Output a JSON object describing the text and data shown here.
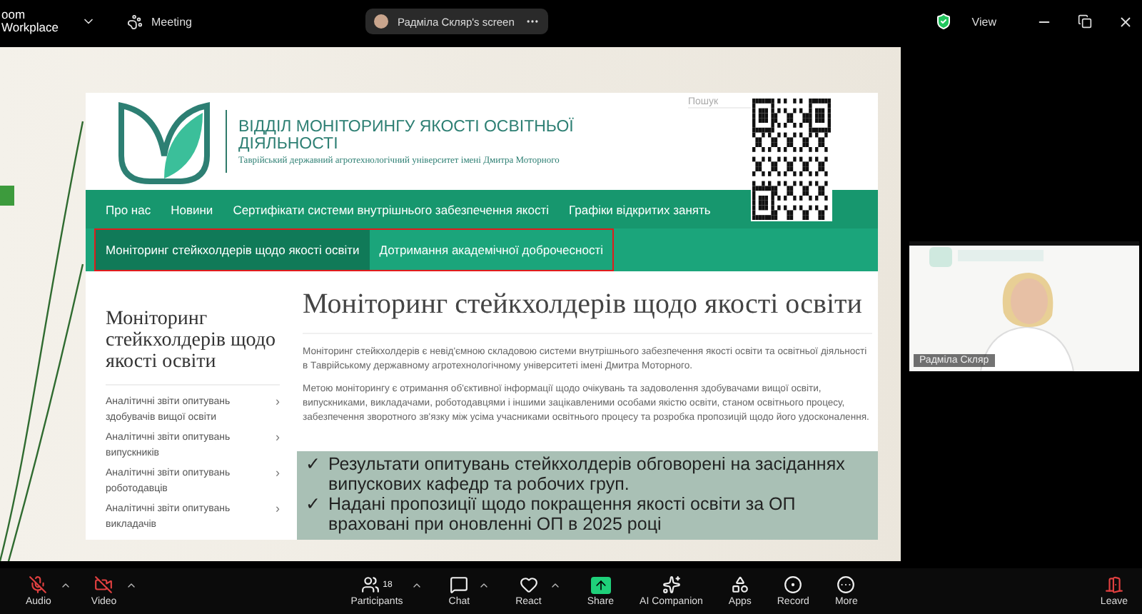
{
  "top_bar": {
    "app_name": "oom",
    "app_subname": "Workplace",
    "meeting_label": "Meeting",
    "share_pill": "Радміла Скляр's screen",
    "view_label": "View"
  },
  "slide": {
    "site": {
      "title": "ВІДДІЛ МОНІТОРИНГУ ЯКОСТІ ОСВІТНЬОЇ ДІЯЛЬНОСТІ",
      "subtitle": "Таврійський державний агротехнологічний університет імені Дмитра Моторного",
      "search_placeholder": "Пошук",
      "nav": [
        {
          "label": "Про нас"
        },
        {
          "label": "Новини"
        },
        {
          "label": "Сертифікати системи внутрішнього забезпечення якості"
        },
        {
          "label": "Графіки відкритих занять"
        }
      ],
      "subnav": {
        "outlined": true,
        "items": [
          {
            "label": "Моніторинг стейкхолдерів щодо якості освіти",
            "selected": true
          },
          {
            "label": "Дотримання академічної доброчесності",
            "selected": false
          }
        ]
      },
      "sidebar": {
        "title": "Моніторинг стейкхолдерів щодо якості освіти",
        "items": [
          {
            "label": "Аналітичні звіти опитувань здобувачів вищої освіти",
            "arrow": "›"
          },
          {
            "label": "Аналітичні звіти опитувань випускників",
            "arrow": "›"
          },
          {
            "label": "Аналітичні звіти опитувань роботодавців",
            "arrow": "›"
          },
          {
            "label": "Аналітичні звіти опитувань викладачів",
            "arrow": "›"
          }
        ]
      },
      "heading": "Моніторинг стейкхолдерів щодо якості освіти",
      "paragraphs": [
        "Моніторинг стейкхолдерів є невід'ємною складовою системи внутрішнього забезпечення якості освіти та освітньої діяльності в Таврійському державному агротехнологічному університеті імені Дмитра  Моторного.",
        "Метою моніторингу є отримання об'єктивної інформації щодо очікувань та задоволення здобувачами вищої освіти, випускниками, викладачами, роботодавцями і іншими зацікавленими особами якістю освіти, станом освітнього процесу, забезпечення зворотного зв'язку між усіма учасниками освітнього процесу та розробка пропозицій щодо його удосконалення."
      ]
    },
    "callout": [
      {
        "mark": "✓",
        "text": "Результати опитувань стейкхолдерів обговорені на засіданнях випускових кафедр та робочих груп."
      },
      {
        "mark": "✓",
        "text": "Надані пропозиції щодо покращення якості освіти за ОП враховані при оновленні ОП в 2025 році"
      }
    ]
  },
  "video_tile": {
    "name": "Радміла Скляр"
  },
  "toolbar": {
    "left": [
      {
        "kind": "audio",
        "label": "Audio",
        "muted": true
      },
      {
        "kind": "video",
        "label": "Video",
        "muted": true
      }
    ],
    "center": [
      {
        "kind": "participants",
        "label": "Participants",
        "count": "18"
      },
      {
        "kind": "chat",
        "label": "Chat"
      },
      {
        "kind": "react",
        "label": "React"
      },
      {
        "kind": "share",
        "label": "Share"
      },
      {
        "kind": "ai",
        "label": "AI Companion"
      },
      {
        "kind": "apps",
        "label": "Apps"
      },
      {
        "kind": "record",
        "label": "Record"
      },
      {
        "kind": "more",
        "label": "More"
      }
    ],
    "right": [
      {
        "kind": "leave",
        "label": "Leave"
      }
    ]
  }
}
